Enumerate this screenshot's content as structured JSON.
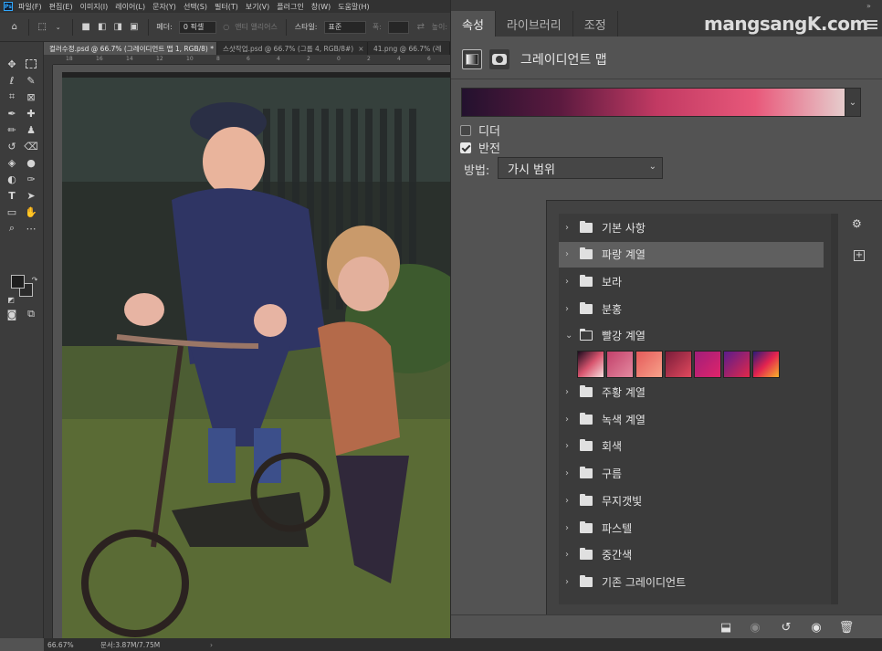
{
  "app": {
    "menu": [
      "파일(F)",
      "편집(E)",
      "이미지(I)",
      "레이어(L)",
      "문자(Y)",
      "선택(S)",
      "필터(T)",
      "보기(V)",
      "플러그인",
      "창(W)",
      "도움말(H)"
    ]
  },
  "options_bar": {
    "feather_label": "페더:",
    "feather_value": "0 픽셀",
    "antialias_label": "앤티 앨리어스",
    "style_label": "스타일:",
    "style_value": "표준",
    "width_label": "폭:",
    "height_label": "높이:"
  },
  "document_tabs": [
    {
      "label": "컬러수정.psd @ 66.7% (그레이디언트 맵 1, RGB/8) *",
      "active": true
    },
    {
      "label": "스샷작업.psd @ 66.7% (그룹 4, RGB/8#)",
      "active": false
    },
    {
      "label": "41.png @ 66.7% (레",
      "active": false
    }
  ],
  "ruler_ticks": [
    "18",
    "16",
    "14",
    "12",
    "10",
    "8",
    "6",
    "4",
    "2",
    "0",
    "2",
    "4",
    "6"
  ],
  "status_bar": {
    "zoom": "66.67%",
    "doc_info": "문서:3.87M/7.75M"
  },
  "panel": {
    "tabs": [
      {
        "label": "속성",
        "active": true
      },
      {
        "label": "라이브러리",
        "active": false
      },
      {
        "label": "조정",
        "active": false
      }
    ],
    "watermark": "mangsangK.com",
    "adjustment_title": "그레이디언트 맵",
    "gradient_colors": [
      "#23112e",
      "#5b1a3f",
      "#c23a63",
      "#e8587a",
      "#e6d7d4"
    ],
    "dither_label": "디더",
    "dither_checked": false,
    "reverse_label": "반전",
    "reverse_checked": true,
    "method_label": "방법:",
    "method_value": "가시 범위"
  },
  "gradient_picker": {
    "groups": [
      {
        "label": "기본 사항",
        "open": false,
        "selected": false
      },
      {
        "label": "파랑 계열",
        "open": false,
        "selected": true
      },
      {
        "label": "보라",
        "open": false,
        "selected": false
      },
      {
        "label": "분홍",
        "open": false,
        "selected": false
      },
      {
        "label": "빨강 계열",
        "open": true,
        "selected": false
      },
      {
        "label": "주황 계열",
        "open": false,
        "selected": false
      },
      {
        "label": "녹색 계열",
        "open": false,
        "selected": false
      },
      {
        "label": "회색",
        "open": false,
        "selected": false
      },
      {
        "label": "구름",
        "open": false,
        "selected": false
      },
      {
        "label": "무지갯빛",
        "open": false,
        "selected": false
      },
      {
        "label": "파스텔",
        "open": false,
        "selected": false
      },
      {
        "label": "중간색",
        "open": false,
        "selected": false
      },
      {
        "label": "기존 그레이디언트",
        "open": false,
        "selected": false
      }
    ],
    "red_swatches": [
      [
        "#1a0b1e",
        "#d8546e",
        "#f6dede"
      ],
      [
        "#c2406a",
        "#e48aa0"
      ],
      [
        "#e55a5a",
        "#f7a28a"
      ],
      [
        "#7a1c3a",
        "#e2495d"
      ],
      [
        "#a01e7a",
        "#e0246a"
      ],
      [
        "#5a1c8c",
        "#e2284a"
      ],
      [
        "#2b1a7a",
        "#e3234f",
        "#f7b32b"
      ]
    ]
  }
}
